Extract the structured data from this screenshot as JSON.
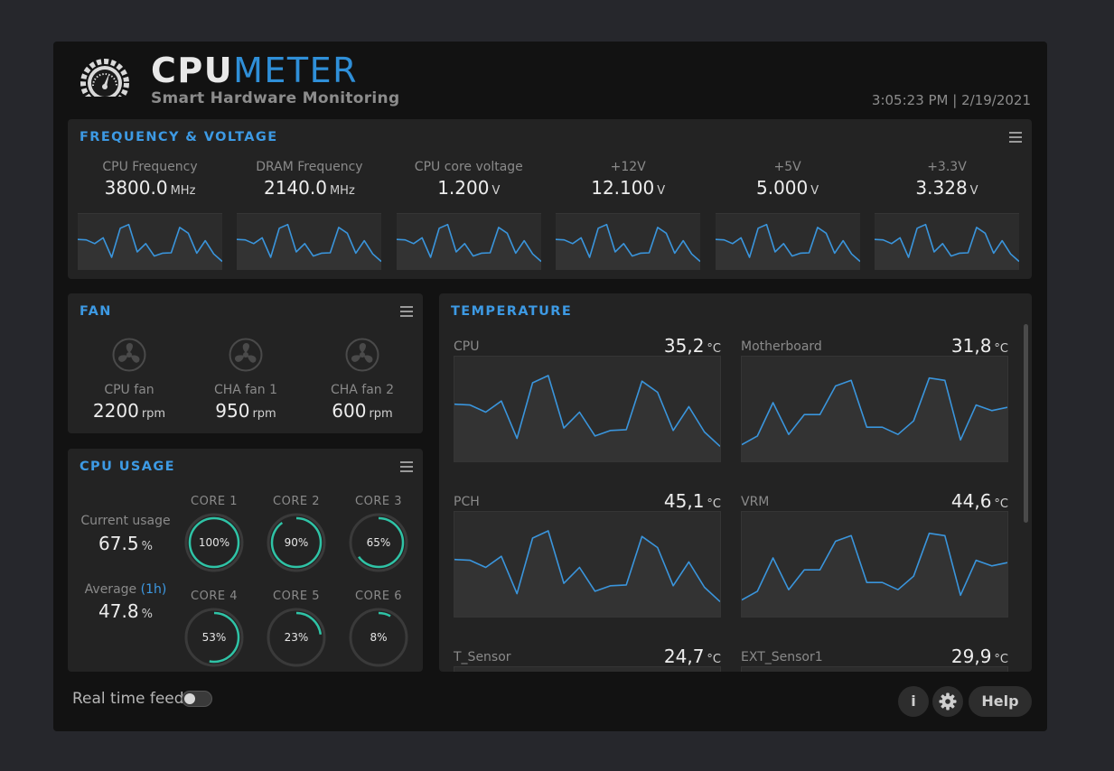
{
  "header": {
    "brand_part1": "CPU",
    "brand_part2": "METER",
    "tagline": "Smart Hardware Monitoring",
    "datetime": "3:05:23 PM | 2/19/2021"
  },
  "frequency_voltage": {
    "title": "FREQUENCY & VOLTAGE",
    "metrics": [
      {
        "label": "CPU Frequency",
        "value": "3800.0",
        "unit": "MHz"
      },
      {
        "label": "DRAM Frequency",
        "value": "2140.0",
        "unit": "MHz"
      },
      {
        "label": "CPU core voltage",
        "value": "1.200",
        "unit": "V"
      },
      {
        "label": "+12V",
        "value": "12.100",
        "unit": "V"
      },
      {
        "label": "+5V",
        "value": "5.000",
        "unit": "V"
      },
      {
        "label": "+3.3V",
        "value": "3.328",
        "unit": "V"
      }
    ]
  },
  "fan": {
    "title": "FAN",
    "items": [
      {
        "label": "CPU fan",
        "value": "2200",
        "unit": "rpm",
        "icon": "fan-icon"
      },
      {
        "label": "CHA fan 1",
        "value": "950",
        "unit": "rpm",
        "icon": "fan-icon"
      },
      {
        "label": "CHA fan 2",
        "value": "600",
        "unit": "rpm",
        "icon": "fan-icon"
      }
    ]
  },
  "cpu_usage": {
    "title": "CPU USAGE",
    "current_label": "Current usage",
    "current_value": "67.5",
    "current_unit": "%",
    "average_label": "Average",
    "average_period": "(1h)",
    "average_value": "47.8",
    "average_unit": "%",
    "cores": [
      {
        "label": "CORE 1",
        "value": "100%",
        "percent": 100
      },
      {
        "label": "CORE 2",
        "value": "90%",
        "percent": 90
      },
      {
        "label": "CORE 3",
        "value": "65%",
        "percent": 65
      },
      {
        "label": "CORE 4",
        "value": "53%",
        "percent": 53
      },
      {
        "label": "CORE 5",
        "value": "23%",
        "percent": 23
      },
      {
        "label": "CORE 6",
        "value": "8%",
        "percent": 8
      }
    ]
  },
  "temperature": {
    "title": "TEMPERATURE",
    "sensors": [
      {
        "label": "CPU",
        "value": "35,2",
        "unit": "°C"
      },
      {
        "label": "Motherboard",
        "value": "31,8",
        "unit": "°C"
      },
      {
        "label": "PCH",
        "value": "45,1",
        "unit": "°C"
      },
      {
        "label": "VRM",
        "value": "44,6",
        "unit": "°C"
      },
      {
        "label": "T_Sensor",
        "value": "24,7",
        "unit": "°C"
      },
      {
        "label": "EXT_Sensor1",
        "value": "29,9",
        "unit": "°C"
      }
    ]
  },
  "footer": {
    "realtime_label": "Real time feed",
    "realtime_on": false,
    "info_label": "i",
    "help_label": "Help"
  },
  "colors": {
    "accent": "#3d9ae4",
    "gauge": "#2fc3a6",
    "line": "#3a95dc"
  }
}
